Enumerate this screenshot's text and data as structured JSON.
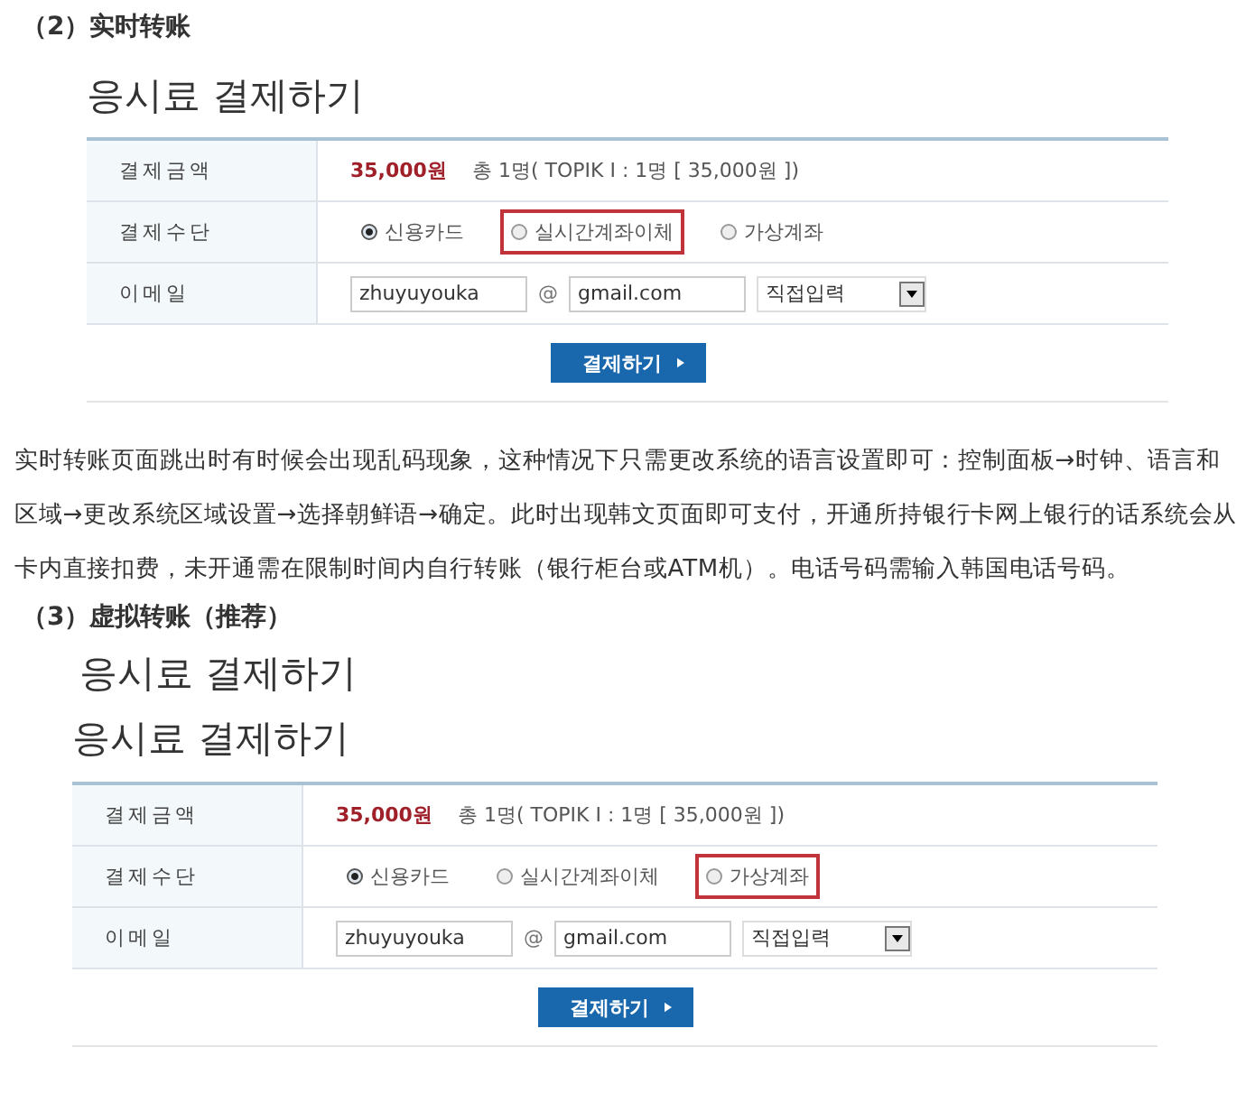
{
  "sections": [
    {
      "kind": "heading",
      "text": "（2）实时转账"
    },
    {
      "kind": "form",
      "titles": [
        "응시료 결제하기"
      ],
      "amount_label": "결제금액",
      "amount": "35,000원",
      "amount_detail": "총 1명( TOPIK Ⅰ : 1명 [ 35,000원 ])",
      "method_label": "결제수단",
      "options": [
        {
          "label": "신용카드",
          "selected": true,
          "highlighted": false
        },
        {
          "label": "실시간계좌이체",
          "selected": false,
          "highlighted": true
        },
        {
          "label": "가상계좌",
          "selected": false,
          "highlighted": false
        }
      ],
      "email_label": "이메일",
      "email_user": "zhuyuyouka",
      "at": "@",
      "email_domain": "gmail.com",
      "domain_select": "직접입력",
      "submit": "결제하기"
    },
    {
      "kind": "paragraph",
      "text": "实时转账页面跳出时有时候会出现乱码现象，这种情况下只需更改系统的语言设置即可：控制面板→时钟、语言和区域→更改系统区域设置→选择朝鲜语→确定。此时出现韩文页面即可支付，开通所持银行卡网上银行的话系统会从卡内直接扣费，未开通需在限制时间内自行转账（银行柜台或ATM机）。电话号码需输入韩国电话号码。"
    },
    {
      "kind": "heading",
      "text": "（3）虚拟转账（推荐）"
    },
    {
      "kind": "form",
      "titles": [
        "응시료 결제하기",
        "응시료 결제하기"
      ],
      "amount_label": "결제금액",
      "amount": "35,000원",
      "amount_detail": "총 1명( TOPIK Ⅰ : 1명 [ 35,000원 ])",
      "method_label": "결제수단",
      "options": [
        {
          "label": "신용카드",
          "selected": true,
          "highlighted": false
        },
        {
          "label": "실시간계좌이체",
          "selected": false,
          "highlighted": false
        },
        {
          "label": "가상계좌",
          "selected": false,
          "highlighted": true
        }
      ],
      "email_label": "이메일",
      "email_user": "zhuyuyouka",
      "at": "@",
      "email_domain": "gmail.com",
      "domain_select": "직접입력",
      "submit": "결제하기"
    }
  ]
}
